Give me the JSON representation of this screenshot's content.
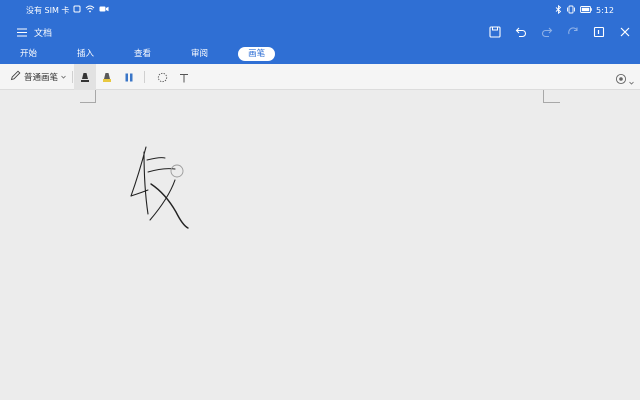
{
  "status": {
    "carrier": "没有 SIM 卡",
    "time": "5:12"
  },
  "title": {
    "doc_name": "文档"
  },
  "tabs": [
    {
      "label": "开始",
      "active": false
    },
    {
      "label": "插入",
      "active": false
    },
    {
      "label": "查看",
      "active": false
    },
    {
      "label": "审阅",
      "active": false
    },
    {
      "label": "画笔",
      "active": true
    }
  ],
  "toolbar": {
    "pen_type": "普通画笔"
  },
  "colors": {
    "brand": "#2f6fd4",
    "ink": "#222222",
    "highlighter": "#e8c840"
  }
}
